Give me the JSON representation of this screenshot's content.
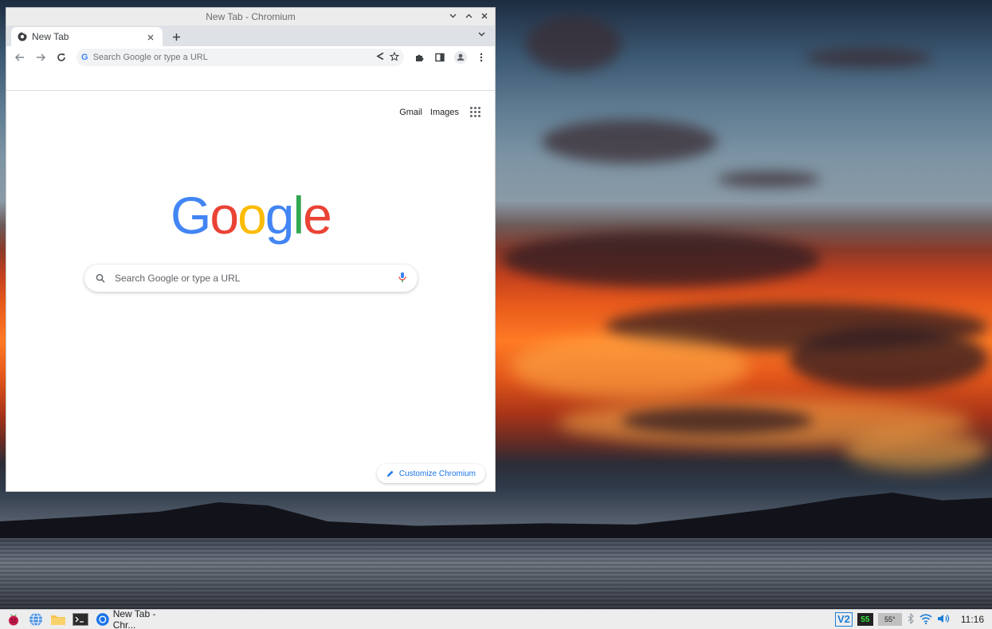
{
  "window": {
    "title": "New Tab - Chromium"
  },
  "tabs": [
    {
      "label": "New Tab"
    }
  ],
  "toolbar": {
    "omnibox_placeholder": "Search Google or type a URL"
  },
  "ntp": {
    "links": {
      "gmail": "Gmail",
      "images": "Images"
    },
    "logo_letters": [
      {
        "char": "G",
        "color": "#4285f4"
      },
      {
        "char": "o",
        "color": "#ea4335"
      },
      {
        "char": "o",
        "color": "#fbbc05"
      },
      {
        "char": "g",
        "color": "#4285f4"
      },
      {
        "char": "l",
        "color": "#34a853"
      },
      {
        "char": "e",
        "color": "#ea4335"
      }
    ],
    "search_placeholder": "Search Google or type a URL",
    "customize_label": "Customize Chromium"
  },
  "taskbar": {
    "task_label": "New Tab - Chr...",
    "vnc_label": "V2",
    "cpu_value": "55",
    "temp_value": "55°",
    "clock": "11:16"
  },
  "colors": {
    "accent": "#1a73e8",
    "vnc": "#1c7ed6",
    "cpu_graph": "#35e23a"
  }
}
